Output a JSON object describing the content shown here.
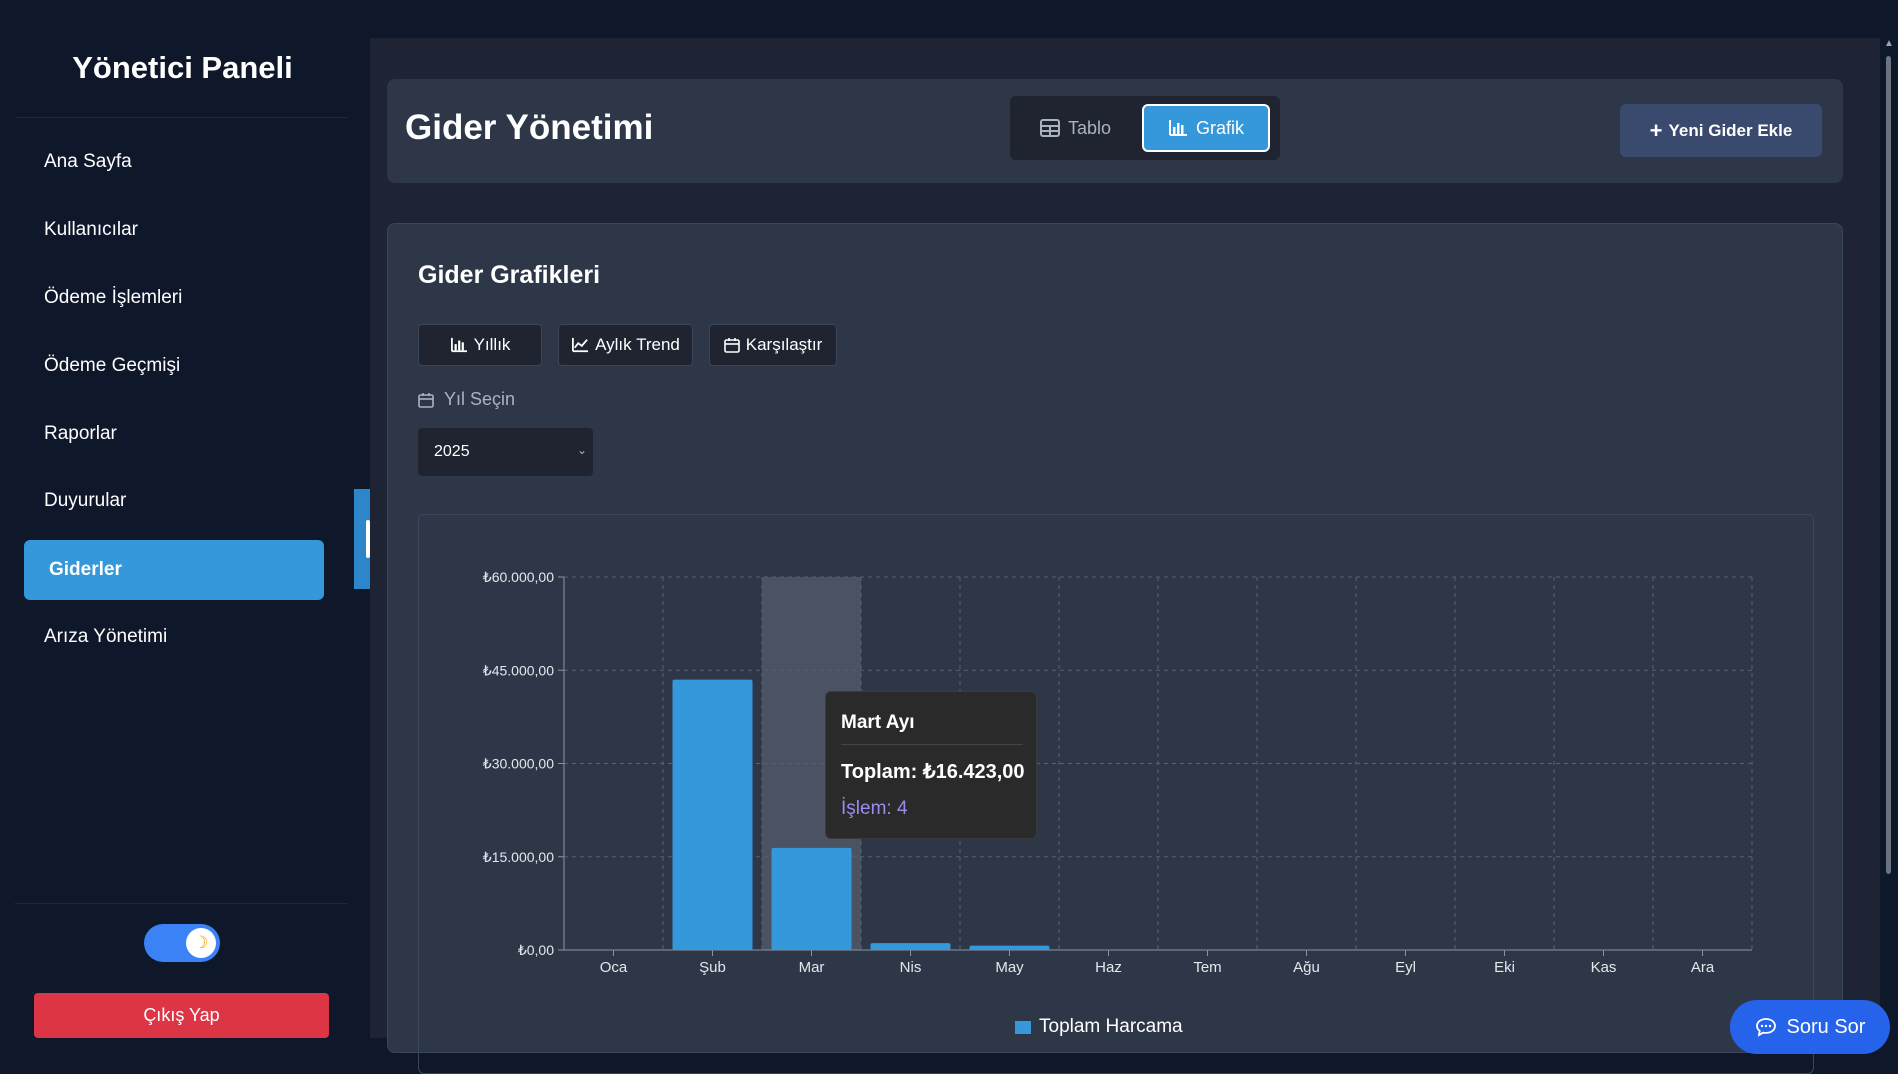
{
  "sidebar": {
    "brand": "Yönetici Paneli",
    "items": [
      {
        "label": "Ana Sayfa"
      },
      {
        "label": "Kullanıcılar"
      },
      {
        "label": "Ödeme İşlemleri"
      },
      {
        "label": "Ödeme Geçmişi"
      },
      {
        "label": "Raporlar"
      },
      {
        "label": "Duyurular"
      },
      {
        "label": "Giderler",
        "active": true
      },
      {
        "label": "Arıza Yönetimi"
      }
    ],
    "logout_label": "Çıkış Yap",
    "theme_icon": "moon-icon"
  },
  "header": {
    "title": "Gider Yönetimi",
    "view_tabs": [
      {
        "label": "Tablo",
        "icon": "table-icon"
      },
      {
        "label": "Grafik",
        "icon": "bar-chart-icon",
        "active": true
      }
    ],
    "new_button": "Yeni Gider Ekle"
  },
  "charts_panel": {
    "title": "Gider Grafikleri",
    "chart_types": [
      {
        "label": "Yıllık",
        "icon": "bar-chart-icon"
      },
      {
        "label": "Aylık Trend",
        "icon": "line-chart-icon"
      },
      {
        "label": "Karşılaştır",
        "icon": "calendar-icon"
      }
    ],
    "year_label": "Yıl Seçin",
    "year_value": "2025"
  },
  "tooltip": {
    "title": "Mart Ayı",
    "total": "Toplam: ₺16.423,00",
    "count": "İşlem: 4"
  },
  "chat_button": "Soru Sor",
  "chart_data": {
    "type": "bar",
    "categories": [
      "Oca",
      "Şub",
      "Mar",
      "Nis",
      "May",
      "Haz",
      "Tem",
      "Ağu",
      "Eyl",
      "Eki",
      "Kas",
      "Ara"
    ],
    "series": [
      {
        "name": "Toplam Harcama",
        "values": [
          0,
          43500,
          16423,
          1100,
          700,
          0,
          0,
          0,
          0,
          0,
          0,
          0
        ],
        "color": "#3498db"
      }
    ],
    "y_ticks": [
      "₺0,00",
      "₺15.000,00",
      "₺30.000,00",
      "₺45.000,00",
      "₺60.000,00"
    ],
    "ylim": [
      0,
      60000
    ],
    "highlight_category": "Mar",
    "grid": true,
    "legend": "bottom"
  }
}
